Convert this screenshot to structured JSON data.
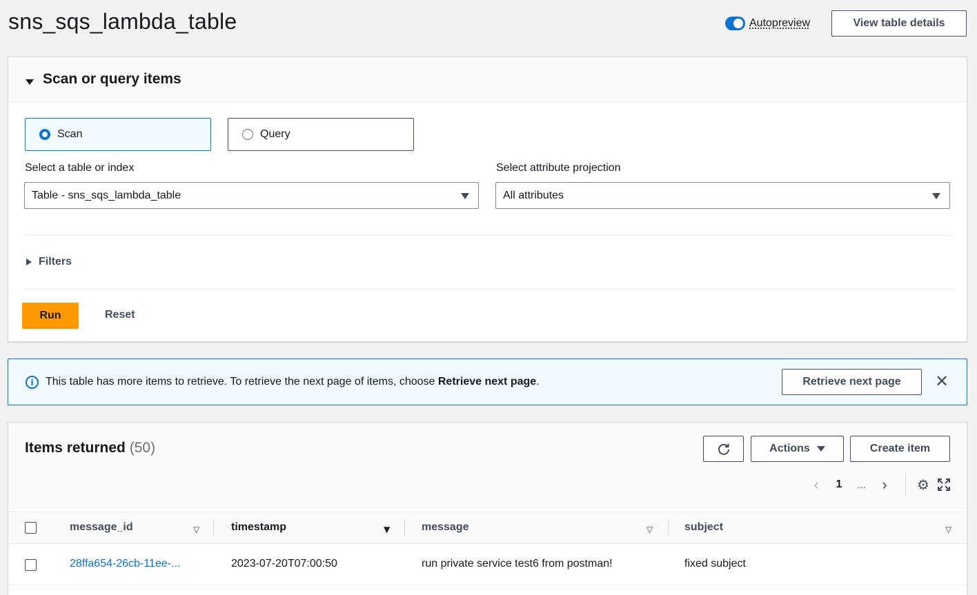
{
  "page": {
    "title": "sns_sqs_lambda_table",
    "autopreview_label": "Autopreview",
    "autopreview_on": true,
    "view_details_label": "View table details"
  },
  "scan_panel": {
    "title": "Scan or query items",
    "modes": [
      {
        "label": "Scan",
        "selected": true
      },
      {
        "label": "Query",
        "selected": false
      }
    ],
    "table_select": {
      "label": "Select a table or index",
      "value": "Table - sns_sqs_lambda_table"
    },
    "projection_select": {
      "label": "Select attribute projection",
      "value": "All attributes"
    },
    "filters_label": "Filters",
    "run_label": "Run",
    "reset_label": "Reset"
  },
  "info_bar": {
    "text": "This table has more items to retrieve. To retrieve the next page of items, choose ",
    "emphasis": "Retrieve next page",
    "suffix": ".",
    "button_label": "Retrieve next page"
  },
  "items": {
    "title": "Items returned",
    "count": "(50)",
    "actions_label": "Actions",
    "create_label": "Create item",
    "pagination": {
      "current_page": "1",
      "ellipsis": "..."
    },
    "columns": [
      {
        "label": "message_id"
      },
      {
        "label": "timestamp"
      },
      {
        "label": "message"
      },
      {
        "label": "subject"
      }
    ],
    "rows": [
      {
        "message_id": "28ffa654-26cb-11ee-...",
        "timestamp": "2023-07-20T07:00:50",
        "message": "run private service test6 from postman!",
        "subject": "fixed subject"
      }
    ]
  },
  "colors": {
    "primary": "#0972d3",
    "run_button": "#ff9900",
    "info_background": "#f1faff"
  }
}
